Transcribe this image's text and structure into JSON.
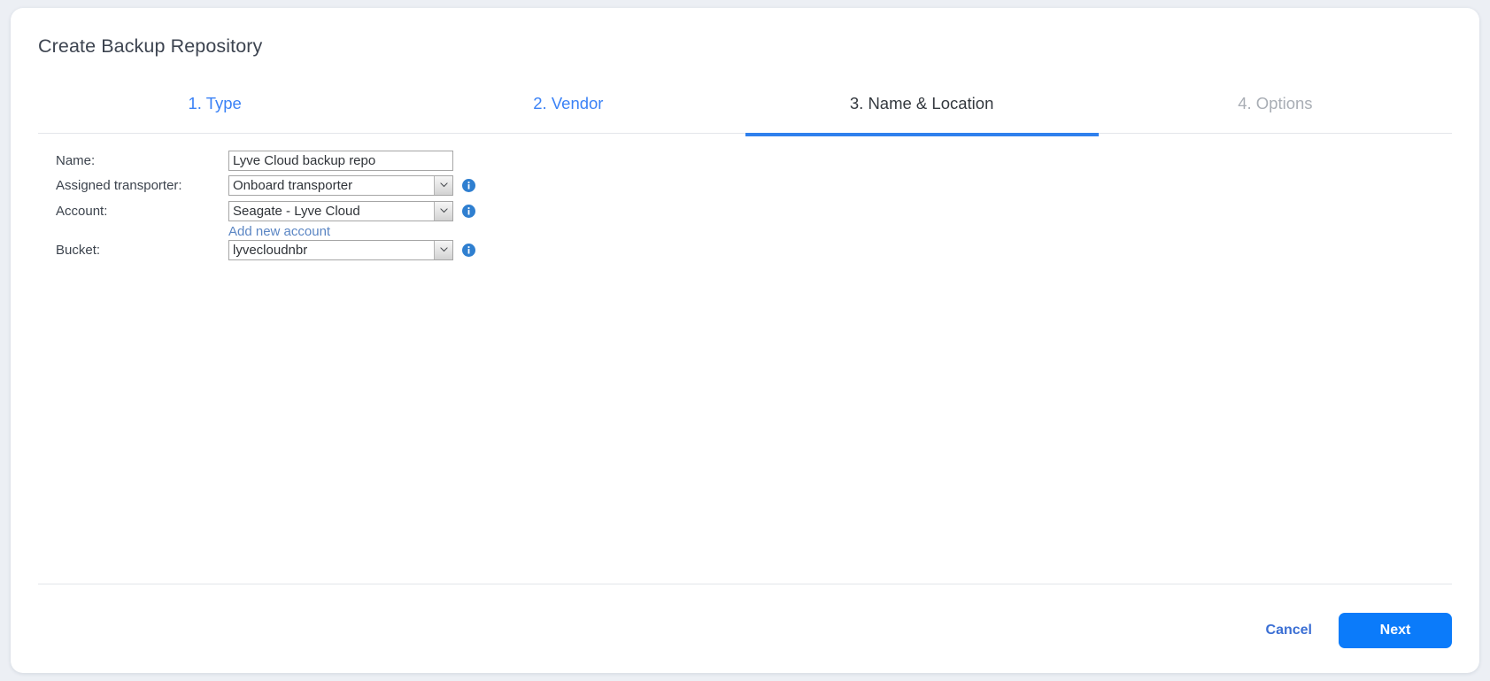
{
  "dialog": {
    "title": "Create Backup Repository"
  },
  "wizard": {
    "tabs": [
      {
        "label": "1. Type",
        "state": "done"
      },
      {
        "label": "2. Vendor",
        "state": "done"
      },
      {
        "label": "3. Name & Location",
        "state": "active"
      },
      {
        "label": "4. Options",
        "state": "todo"
      }
    ]
  },
  "form": {
    "name": {
      "label": "Name:",
      "value": "Lyve Cloud backup repo",
      "placeholder": ""
    },
    "transporter": {
      "label": "Assigned transporter:",
      "value": "Onboard transporter"
    },
    "account": {
      "label": "Account:",
      "value": "Seagate - Lyve Cloud"
    },
    "add_account_link": "Add new account",
    "bucket": {
      "label": "Bucket:",
      "value": "lyvecloudnbr"
    }
  },
  "footer": {
    "cancel_label": "Cancel",
    "next_label": "Next"
  },
  "colors": {
    "accent": "#0b7bfa",
    "tab_done": "#3b82f6",
    "tab_active": "#34393f",
    "tab_todo": "#a9aeb5",
    "link": "#5b86c4",
    "info_icon": "#2f7fd0",
    "page_background": "#eceff4",
    "dialog_background": "#ffffff"
  },
  "icons": {
    "chevron_down": "chevron-down-icon",
    "info": "info-icon"
  }
}
